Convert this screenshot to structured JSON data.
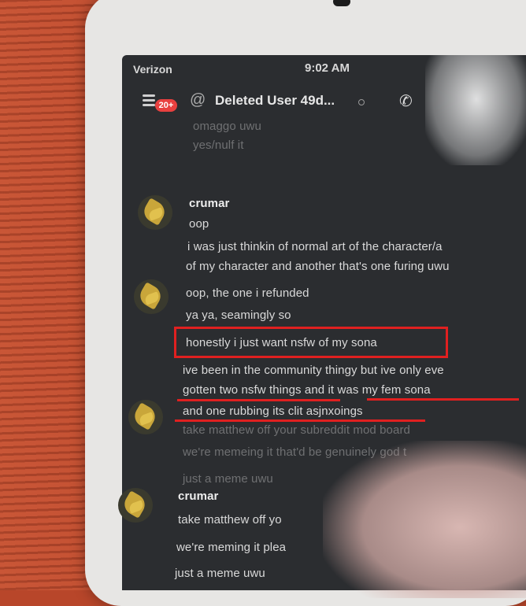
{
  "status_bar": {
    "carrier": "Verizon",
    "time": "9:02 AM"
  },
  "header": {
    "badge": "20+",
    "title": "Deleted User 49d..."
  },
  "messages": {
    "ghost1": "omaggo uwu",
    "ghost2": "yes/nulf it",
    "group1_name": "crumar",
    "group1_lines": [
      "oop",
      "i was just thinkin of normal art of the character/a",
      "of my character and another that's one furing uwu"
    ],
    "group2_lines": [
      "oop, the one i refunded",
      "ya ya, seamingly so"
    ],
    "highlighted": "honestly i just want nsfw of my sona",
    "group3_lines": [
      "ive been in the community thingy but ive only eve",
      "gotten two nsfw things and it was my fem sona",
      "and one rubbing its clit asjnxoings"
    ],
    "ghost3": "take matthew off your subreddit mod board",
    "ghost4": "we're memeing it that'd be genuinely god t",
    "ghost5": "just a meme uwu",
    "group4_name": "crumar",
    "group4_lines": [
      "take matthew off yo",
      "we're meming it plea",
      "just a meme uwu"
    ]
  }
}
